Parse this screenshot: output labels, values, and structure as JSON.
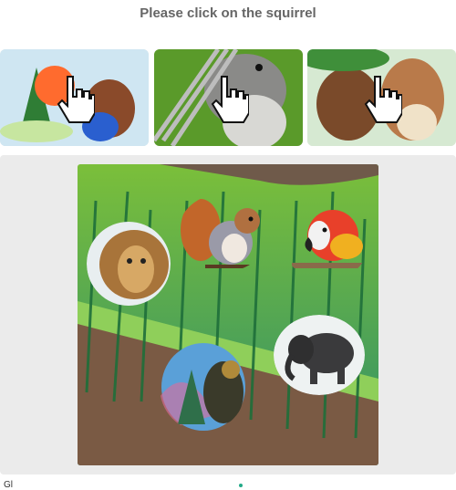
{
  "prompt": "Please click on the squirrel",
  "examples": [
    {
      "name": "example-1",
      "icon": "pointing-hand-cursor-icon"
    },
    {
      "name": "example-2",
      "icon": "pointing-hand-cursor-icon"
    },
    {
      "name": "example-3",
      "icon": "pointing-hand-cursor-icon"
    }
  ],
  "scene": {
    "animals": [
      "lion",
      "squirrel",
      "parrot",
      "elephant",
      "bear"
    ]
  },
  "footer": {
    "left_text": "Gl"
  },
  "colors": {
    "prompt": "#666666",
    "panel": "#ebebeb"
  }
}
